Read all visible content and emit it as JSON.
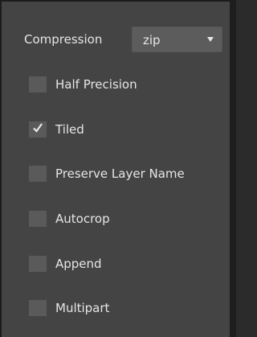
{
  "compression": {
    "label": "Compression",
    "selected": "zip"
  },
  "options": [
    {
      "label": "Half Precision",
      "checked": false
    },
    {
      "label": "Tiled",
      "checked": true
    },
    {
      "label": "Preserve Layer Name",
      "checked": false
    },
    {
      "label": "Autocrop",
      "checked": false
    },
    {
      "label": "Append",
      "checked": false
    },
    {
      "label": "Multipart",
      "checked": false
    }
  ]
}
